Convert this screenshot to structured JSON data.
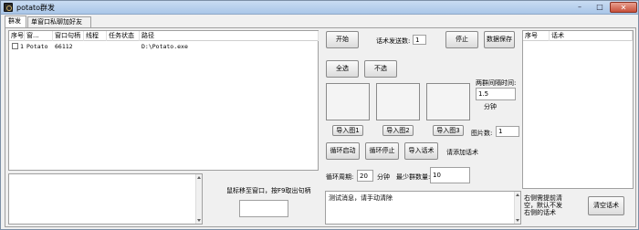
{
  "window": {
    "title": "potato群发",
    "minimize_label": "–",
    "maximize_label": "□",
    "close_label": "✕"
  },
  "tabs": [
    {
      "label": "群发"
    },
    {
      "label": "单窗口私聊加好友"
    }
  ],
  "grid": {
    "columns": [
      "序号",
      "窗...",
      "窗口句柄",
      "线程",
      "任务状态",
      "路径"
    ],
    "rows": [
      {
        "index": "1",
        "name": "Potato",
        "handle": "66112",
        "thread": "",
        "status": "",
        "path": "D:\\Potato.exe"
      }
    ]
  },
  "controls": {
    "start_label": "开始",
    "send_count_label": "话术发送数:",
    "send_count_value": "1",
    "stop_label": "停止",
    "save_label": "数据保存",
    "select_all_label": "全选",
    "deselect_label": "不选",
    "interval_label": "两群间隔时间:",
    "interval_value": "1.5",
    "interval_unit": "分钟",
    "import1_label": "导入图1",
    "import2_label": "导入图2",
    "import3_label": "导入图3",
    "image_count_label": "图片数:",
    "image_count_value": "1",
    "loop_start_label": "循环启动",
    "loop_stop_label": "循环停止",
    "import_speech_label": "导入话术",
    "add_speech_hint": "请添加话术",
    "loop_period_label": "循环周期:",
    "loop_period_value": "20",
    "loop_period_unit": "分钟",
    "min_groups_label": "最少群数量:",
    "min_groups_value": "10",
    "hover_hint": "鼠标移至窗口，按F9取出句柄",
    "handle_input_value": "",
    "message_text": "测试消息，请手动清除",
    "side_hint": "右侧需提前清空，默认不发右侧的话术",
    "clear_speech_label": "清空话术"
  },
  "speech_list": {
    "columns": [
      "序号",
      "话术"
    ]
  }
}
